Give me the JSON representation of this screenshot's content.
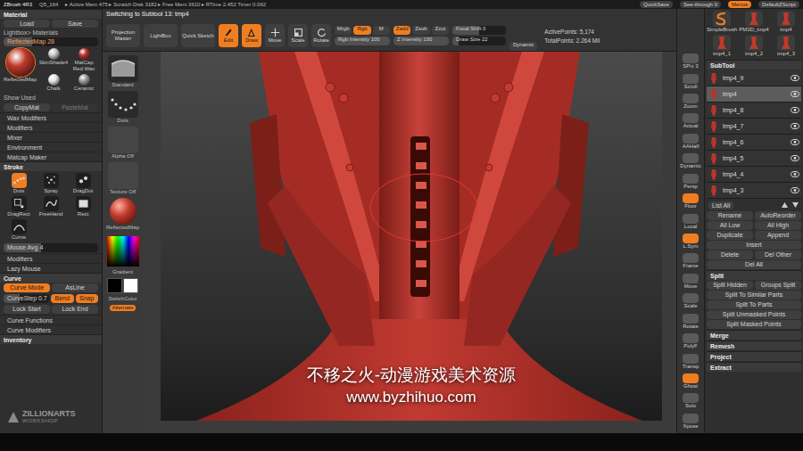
{
  "title_bar": {
    "app": "ZBrush 4R3",
    "file": "Q5_164",
    "stats": "▸ Active Mem 475 ▸ Scratch Disk 3182 ▸ Free Mem 3610 ▸ RTime 2.452 Timer 0.062",
    "buttons": [
      {
        "label": "QuickSave",
        "selected": false
      },
      {
        "label": "See-through 0",
        "selected": false
      },
      {
        "label": "Menus",
        "selected": true
      },
      {
        "label": "DefaultZScript",
        "selected": false
      }
    ]
  },
  "notice": "Switching to Subtool 13: tmp4",
  "toolbar": {
    "modes": [
      {
        "label": "Projection Master",
        "selected": false
      },
      {
        "label": "LightBox",
        "selected": false
      },
      {
        "label": "Quick Sketch",
        "selected": false
      }
    ],
    "tools": [
      {
        "label": "Edit",
        "selected": true
      },
      {
        "label": "Draw",
        "selected": true
      },
      {
        "label": "Move",
        "selected": false
      },
      {
        "label": "Scale",
        "selected": false
      },
      {
        "label": "Rotate",
        "selected": false
      }
    ],
    "color_modes": [
      {
        "label": "Mrgb",
        "selected": false
      },
      {
        "label": "Rgb",
        "selected": true
      },
      {
        "label": "M",
        "selected": false
      }
    ],
    "rgb_intensity": {
      "label": "Rgb Intensity 100",
      "level": 1
    },
    "z_modes": [
      {
        "label": "Zadd",
        "selected": true
      },
      {
        "label": "Zsub",
        "selected": false
      },
      {
        "label": "Zcut",
        "selected": false
      }
    ],
    "z_intensity": {
      "label": "Z Intensity 100",
      "level": 1
    },
    "focal_shift": {
      "label": "Focal Shift 0",
      "level": 0.5
    },
    "draw_size": {
      "label": "Draw Size 22",
      "level": 0.12
    },
    "dynamic": {
      "label": "Dynamic",
      "selected": false
    },
    "active_points": "ActivePoints: 5,174",
    "total_points": "TotalPoints: 2.264 Mil"
  },
  "material": {
    "title": "Material",
    "buttons": [
      "Load",
      "Save"
    ],
    "lightbox": "Lightbox> Materials",
    "current": {
      "label": "ReflectedMap 28",
      "level": 0.3
    },
    "swatches": [
      {
        "label": "ReflectedMap",
        "color": "#c0392b",
        "selected": true
      },
      {
        "label": "SkinShade4",
        "color": "#c8c8c8",
        "selected": false
      },
      {
        "label": "MatCap Red Wax",
        "color": "#b8342a",
        "selected": false
      },
      {
        "label": "Chalk",
        "color": "#e6e6e6",
        "selected": false
      },
      {
        "label": "Ceramic",
        "color": "#9a9a9a",
        "selected": false
      }
    ],
    "show_used": "Show Used",
    "copy_paste": [
      "CopyMat",
      "PasteMat"
    ],
    "subpalettes": [
      "Wax Modifiers",
      "Modifiers",
      "Mixer",
      "Environment",
      "Matcap Maker"
    ]
  },
  "stroke": {
    "title": "Stroke",
    "types": [
      {
        "label": "Dots",
        "selected": true
      },
      {
        "label": "Spray",
        "selected": false
      },
      {
        "label": "DragDot",
        "selected": false
      },
      {
        "label": "DragRect",
        "selected": false
      },
      {
        "label": "FreeHand",
        "selected": false
      },
      {
        "label": "Rect",
        "selected": false
      },
      {
        "label": "Curve",
        "selected": false
      }
    ],
    "mouse_avg": {
      "label": "Mouse Avg 4",
      "level": 0.4
    },
    "subpalettes": [
      "Modifiers",
      "Lazy Mouse"
    ],
    "curve_title": "Curve",
    "curve_rows": [
      [
        {
          "label": "Curve Mode",
          "selected": true,
          "kind": "button"
        },
        {
          "label": "AsLine",
          "selected": false,
          "kind": "button"
        }
      ],
      [
        {
          "label": "CurveStep 0.7",
          "selected": false,
          "kind": "slider",
          "level": 0.35
        },
        {
          "label": "Bend",
          "selected": true,
          "kind": "button"
        },
        {
          "label": "Snap",
          "selected": true,
          "kind": "button"
        }
      ],
      [
        {
          "label": "Lock Start",
          "selected": false,
          "kind": "button"
        },
        {
          "label": "Lock End",
          "selected": false,
          "kind": "button"
        }
      ]
    ],
    "curve_subpalettes": [
      "Curve Functions",
      "Curve Modifiers"
    ],
    "inventory": "Inventory"
  },
  "logo": {
    "top": "ZILLIONARTS",
    "bottom": "WORKSHOP"
  },
  "brush_column": {
    "slots": [
      {
        "label": "Standard",
        "kind": "brush"
      },
      {
        "label": "Dots",
        "kind": "stroke"
      },
      {
        "label": "Alpha Off",
        "kind": "alpha"
      },
      {
        "label": "Texture Off",
        "kind": "texture"
      },
      {
        "label": "ReflectedMap",
        "kind": "material"
      }
    ],
    "gradient": "Gradient",
    "main_color": "#000000",
    "secondary_color": "#ffffff",
    "switch": "SwitchColor",
    "alternate": {
      "label": "Alternate",
      "selected": true
    }
  },
  "viewport": {
    "watermark": [
      "不移之火-动漫游戏美术资源",
      "www.byzhihuo.com"
    ]
  },
  "view_tools": [
    {
      "label": "SPix 3",
      "selected": false
    },
    {
      "label": "Scroll",
      "selected": false
    },
    {
      "label": "Zoom",
      "selected": false
    },
    {
      "label": "Actual",
      "selected": false
    },
    {
      "label": "AAHalf",
      "selected": false
    },
    {
      "label": "Dynamic",
      "selected": false
    },
    {
      "label": "Persp",
      "selected": false
    },
    {
      "label": "Floor",
      "selected": true
    },
    {
      "label": "Local",
      "selected": false
    },
    {
      "label": "L.Sym",
      "selected": true
    },
    {
      "label": "Frame",
      "selected": false
    },
    {
      "label": "Move",
      "selected": false
    },
    {
      "label": "Scale",
      "selected": false
    },
    {
      "label": "Rotate",
      "selected": false
    },
    {
      "label": "PolyF",
      "selected": false
    },
    {
      "label": "Transp",
      "selected": false
    },
    {
      "label": "Ghost",
      "selected": true
    },
    {
      "label": "Solo",
      "selected": false
    },
    {
      "label": "Xpose",
      "selected": false
    }
  ],
  "tool_thumbs": [
    {
      "label": "SimpleBrush",
      "kind": "brush"
    },
    {
      "label": "PM3D_tmp4",
      "kind": "model"
    },
    {
      "label": "tmp4",
      "kind": "model"
    },
    {
      "label": "tmp4_1",
      "kind": "model"
    },
    {
      "label": "tmp4_2",
      "kind": "model"
    },
    {
      "label": "tmp4_3",
      "kind": "model"
    }
  ],
  "subtool": {
    "title": "SubTool",
    "items": [
      {
        "name": "tmp4_9",
        "visible": true,
        "selected": false
      },
      {
        "name": "tmp4",
        "visible": true,
        "selected": true
      },
      {
        "name": "tmp4_8",
        "visible": true,
        "selected": false
      },
      {
        "name": "tmp4_7",
        "visible": true,
        "selected": false
      },
      {
        "name": "tmp4_6",
        "visible": true,
        "selected": false
      },
      {
        "name": "tmp4_5",
        "visible": true,
        "selected": false
      },
      {
        "name": "tmp4_4",
        "visible": true,
        "selected": false
      },
      {
        "name": "tmp4_3",
        "visible": true,
        "selected": false
      }
    ],
    "list_all": "List All",
    "buttons": [
      [
        "Rename",
        "AutoReorder"
      ],
      [
        "All Low",
        "All High"
      ],
      [
        "Duplicate",
        "Append"
      ],
      [
        "Insert"
      ],
      [
        "Delete",
        "Del Other"
      ],
      [
        "Del All"
      ]
    ]
  },
  "split": {
    "title": "Split",
    "buttons": [
      [
        "Split Hidden",
        "Groups Split"
      ],
      [
        "Split To Similar Parts"
      ],
      [
        "Split To Parts"
      ],
      [
        "Split Unmasked Points"
      ],
      [
        "Split Masked Points"
      ]
    ]
  },
  "right_subpalettes": [
    "Merge",
    "Remesh",
    "Project",
    "Extract"
  ]
}
